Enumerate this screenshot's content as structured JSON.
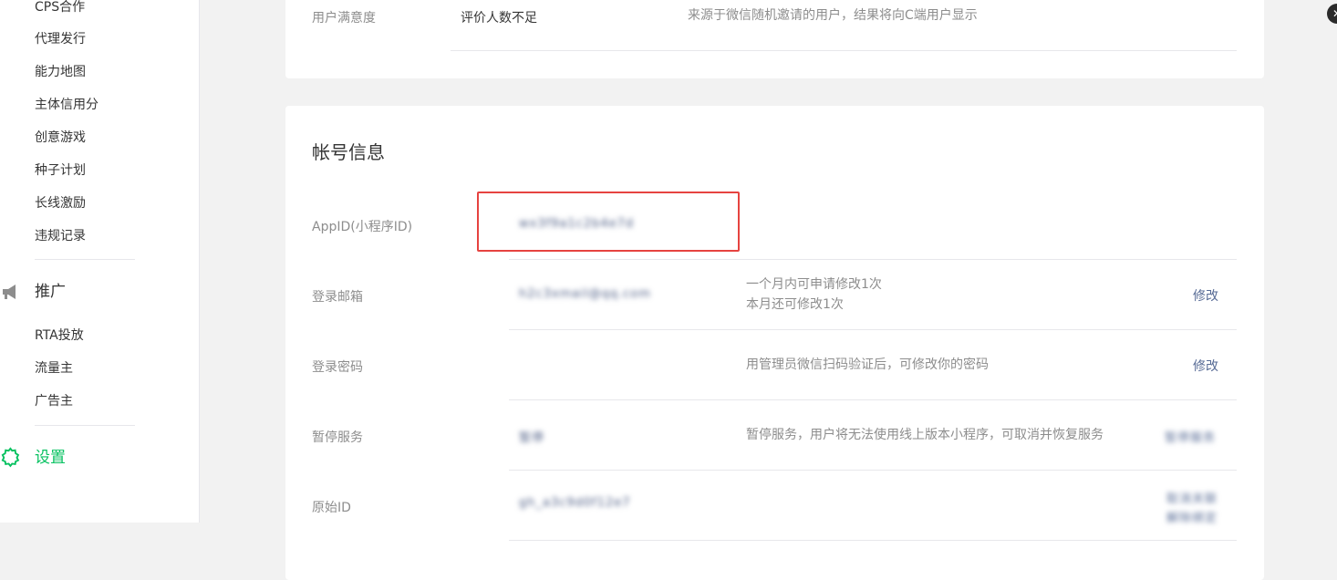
{
  "sidebar": {
    "items_top": [
      "CPS合作",
      "代理发行",
      "能力地图",
      "主体信用分",
      "创意游戏",
      "种子计划",
      "长线激励",
      "违规记录"
    ],
    "promo_group": "推广",
    "promo_items": [
      "RTA投放",
      "流量主",
      "广告主"
    ],
    "settings_group": "设置",
    "accent_color": "#07c160"
  },
  "satisfaction": {
    "label": "用户满意度",
    "value": "评价人数不足",
    "desc": "来源于微信随机邀请的用户，结果将向C端用户显示"
  },
  "account": {
    "title": "帐号信息",
    "appid_label": "AppID(小程序ID)",
    "appid_value": "wx3f9a1c2b4e7d",
    "email_label": "登录邮箱",
    "email_value": "h2c3xmail@qq.com",
    "email_desc1": "一个月内可申请修改1次",
    "email_desc2": "本月还可修改1次",
    "email_action": "修改",
    "password_label": "登录密码",
    "password_desc": "用管理员微信扫码验证后，可修改你的密码",
    "password_action": "修改",
    "pause_label": "暂停服务",
    "pause_value": "暂停",
    "pause_desc": "暂停服务，用户将无法使用线上版本小程序，可取消并恢复服务",
    "pause_action": "暂停服务",
    "origin_label": "原始ID",
    "origin_value": "gh_a3c9d0f12e7",
    "origin_action1": "取消关联",
    "origin_action2": "解除绑定"
  },
  "colors": {
    "link": "#576b95",
    "highlight": "#e64340"
  },
  "icons": {
    "promo": "megaphone-icon",
    "settings": "gear-icon",
    "close": "close-icon"
  }
}
